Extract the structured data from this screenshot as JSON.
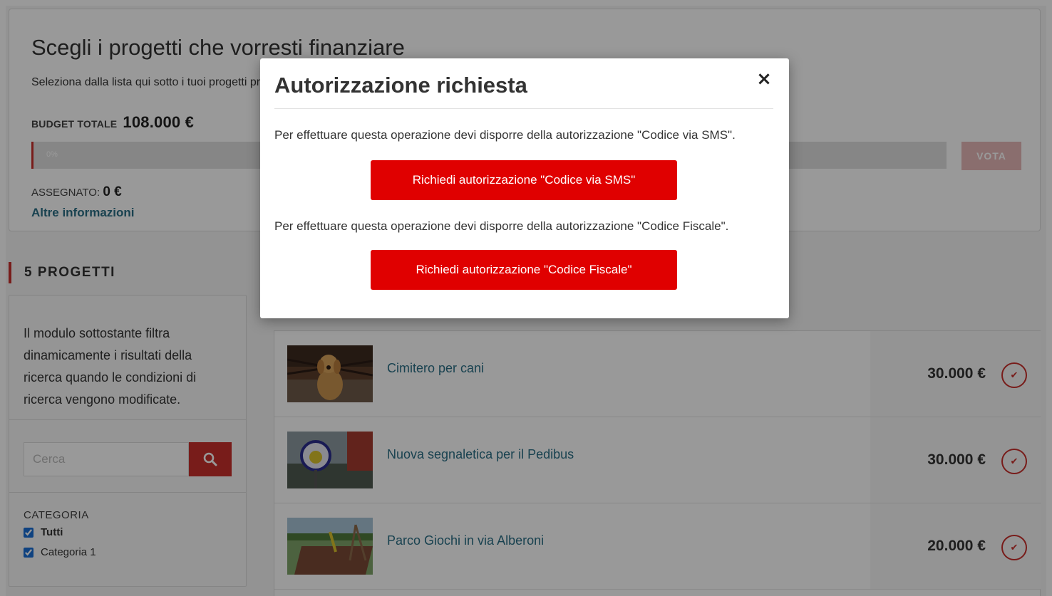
{
  "header": {
    "title": "Scegli i progetti che vorresti finanziare",
    "subtitle": "Seleziona dalla lista qui sotto i tuoi progetti preferiti",
    "budget_label": "BUDGET TOTALE",
    "budget_value": "108.000 €",
    "progress_percent": "0%",
    "progress_fraction": 0,
    "vote_label": "VOTA",
    "assigned_label": "ASSEGNATO:",
    "assigned_value": "0 €",
    "more_info": "Altre informazioni"
  },
  "projects_heading": "5 PROGETTI",
  "sidebar": {
    "description": "Il modulo sottostante filtra dinamicamente i risultati della ricerca quando le condizioni di ricerca vengono modificate.",
    "search_placeholder": "Cerca",
    "category_label": "CATEGORIA",
    "categories": [
      {
        "label": "Tutti",
        "checked": true
      },
      {
        "label": "Categoria 1",
        "checked": true
      }
    ]
  },
  "projects": [
    {
      "name": "Cimitero per cani",
      "price": "30.000 €",
      "thumb": "dog-photo"
    },
    {
      "name": "Nuova segnaletica per il Pedibus",
      "price": "30.000 €",
      "thumb": "sign-photo"
    },
    {
      "name": "Parco Giochi in via Alberoni",
      "price": "20.000 €",
      "thumb": "playground-photo"
    }
  ],
  "modal": {
    "title": "Autorizzazione richiesta",
    "close_symbol": "×",
    "text_sms": "Per effettuare questa operazione devi disporre della autorizzazione \"Codice via SMS\".",
    "button_sms": "Richiedi autorizzazione \"Codice via SMS\"",
    "text_cf": "Per effettuare questa operazione devi disporre della autorizzazione \"Codice Fiscale\".",
    "button_cf": "Richiedi autorizzazione \"Codice Fiscale\""
  },
  "colors": {
    "accent": "#c9302c",
    "modal_button": "#e00000",
    "link": "#2a6f86"
  }
}
